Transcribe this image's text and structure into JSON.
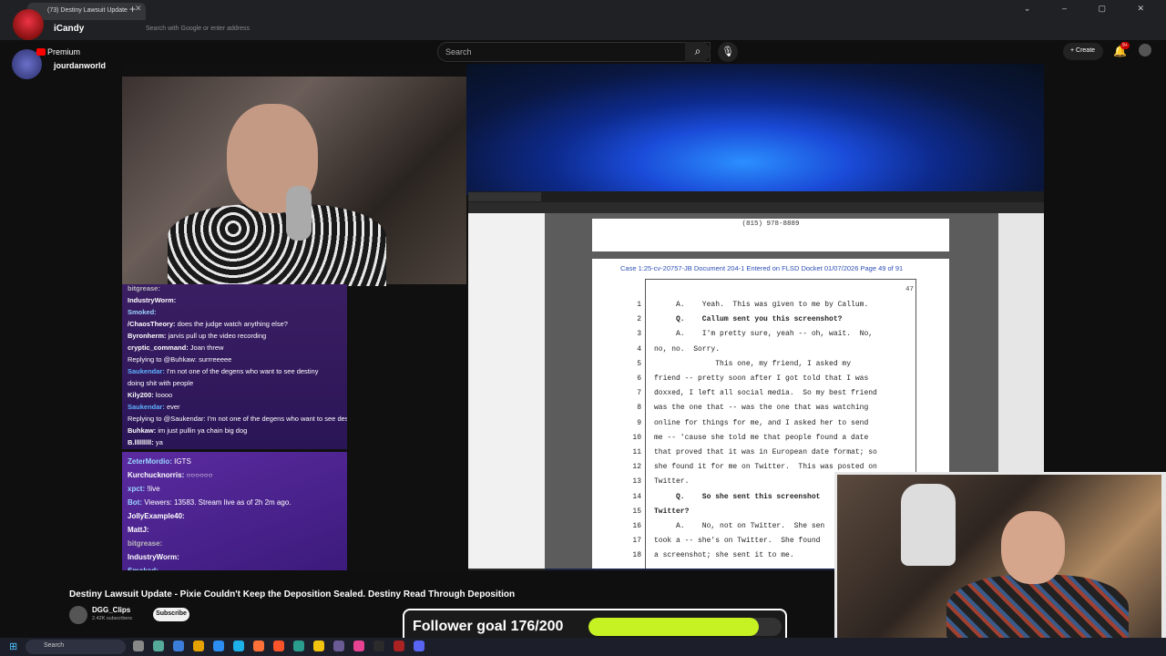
{
  "browser": {
    "tab_title": "(73) Destiny Lawsuit Update",
    "address_placeholder": "Search with Google or enter address"
  },
  "youtube": {
    "search_placeholder": "Search",
    "create_label": "+ Create",
    "notification_count": "9+",
    "video_title": "Destiny Lawsuit Update - Pixie Couldn't Keep the Deposition Sealed. Destiny Read Through Deposition",
    "channel_name": "DGG_Clips",
    "subscribers": "2.42K subscribers",
    "subscribe_label": "Subscribe"
  },
  "overlay": {
    "streamer_name": "iCandy",
    "premium_label": "Premium",
    "account_name": "jourdanworld"
  },
  "chat_top": [
    {
      "user": "bitgrease:",
      "msg": "",
      "color": "#bbbbbb"
    },
    {
      "user": "IndustryWorm:",
      "msg": "",
      "color": "#ffffff"
    },
    {
      "user": "Smoked:",
      "msg": "",
      "color": "#9ad4ff"
    },
    {
      "user": "/ChaosTheory:",
      "msg": "does the judge watch anything else?",
      "color": "#ffffff"
    },
    {
      "user": "Byronherm:",
      "msg": "jarvis pull up the video recording",
      "color": "#ffffff"
    },
    {
      "user": "cryptic_command:",
      "msg": "Joan threw",
      "color": "#ffffff"
    },
    {
      "user": "",
      "msg": "Replying to @Buhkaw: surrreeeee",
      "color": "#cccccc"
    },
    {
      "user": "Saukendar:",
      "msg": "I'm not one of the degens who want to see destiny",
      "color": "#5fb0ff"
    },
    {
      "user": "",
      "msg": "doing shit with people",
      "color": "#ffffff"
    },
    {
      "user": "Kily200:",
      "msg": "loooo",
      "color": "#ffffff"
    },
    {
      "user": "Saukendar:",
      "msg": "ever",
      "color": "#5fb0ff"
    },
    {
      "user": "",
      "msg": "Replying to @Saukendar: I'm not one of the degens who want to see destiny",
      "color": "#cccccc"
    },
    {
      "user": "Buhkaw:",
      "msg": "im just pullin ya chain big dog",
      "color": "#ffffff"
    },
    {
      "user": "B.lllllllll:",
      "msg": "ya",
      "color": "#ffffff"
    }
  ],
  "chat_bottom": [
    {
      "user": "ZeterMordio:",
      "msg": "IGTS",
      "color": "#9ad4ff"
    },
    {
      "user": "Kurchucknorris:",
      "msg": "○○○○○○",
      "color": "#ffffff"
    },
    {
      "user": "xpct:",
      "msg": "!live",
      "color": "#9ad4ff"
    },
    {
      "user": "Bot:",
      "msg": "Viewers: 13583. Stream live as of 2h 2m ago.",
      "color": "#9ad4ff"
    },
    {
      "user": "JollyExample40:",
      "msg": "",
      "color": "#ffffff"
    },
    {
      "user": "MattJ:",
      "msg": "",
      "color": "#ffffff"
    },
    {
      "user": "bitgrease:",
      "msg": "",
      "color": "#bbbbbb"
    },
    {
      "user": "IndustryWorm:",
      "msg": "",
      "color": "#ffffff"
    },
    {
      "user": "Smoked:",
      "msg": "",
      "color": "#9ad4ff"
    }
  ],
  "document": {
    "phone": "(815) 978-8889",
    "case_line": "Case 1:25-cv-20757-JB   Document 204-1   Entered on FLSD Docket 01/07/2026   Page 49 of 91",
    "page_number": "47",
    "lines": [
      {
        "n": "1",
        "t": "     A.    Yeah.  This was given to me by Callum.",
        "bold": false
      },
      {
        "n": "2",
        "t": "     Q.    Callum sent you this screenshot?",
        "bold": true
      },
      {
        "n": "3",
        "t": "     A.    I'm pretty sure, yeah -- oh, wait.  No,",
        "bold": false
      },
      {
        "n": "4",
        "t": "no, no.  Sorry.",
        "bold": false
      },
      {
        "n": "5",
        "t": "              This one, my friend, I asked my",
        "bold": false
      },
      {
        "n": "6",
        "t": "friend -- pretty soon after I got told that I was",
        "bold": false
      },
      {
        "n": "7",
        "t": "doxxed, I left all social media.  So my best friend",
        "bold": false
      },
      {
        "n": "8",
        "t": "was the one that -- was the one that was watching",
        "bold": false
      },
      {
        "n": "9",
        "t": "online for things for me, and I asked her to send",
        "bold": false
      },
      {
        "n": "10",
        "t": "me -- 'cause she told me that people found a date",
        "bold": false
      },
      {
        "n": "11",
        "t": "that proved that it was in European date format; so",
        "bold": false
      },
      {
        "n": "12",
        "t": "she found it for me on Twitter.  This was posted on",
        "bold": false
      },
      {
        "n": "13",
        "t": "Twitter.",
        "bold": false
      },
      {
        "n": "14",
        "t": "     Q.    So she sent this screenshot",
        "bold": true
      },
      {
        "n": "15",
        "t": "Twitter?",
        "bold": true
      },
      {
        "n": "16",
        "t": "     A.    No, not on Twitter.  She sen",
        "bold": false
      },
      {
        "n": "17",
        "t": "took a -- she's on Twitter.  She found",
        "bold": false
      },
      {
        "n": "18",
        "t": "a screenshot; she sent it to me.",
        "bold": false
      }
    ]
  },
  "follower_goal": {
    "label": "Follower goal 176/200",
    "current": 176,
    "target": 200
  },
  "taskbar": {
    "search_label": "Search"
  }
}
